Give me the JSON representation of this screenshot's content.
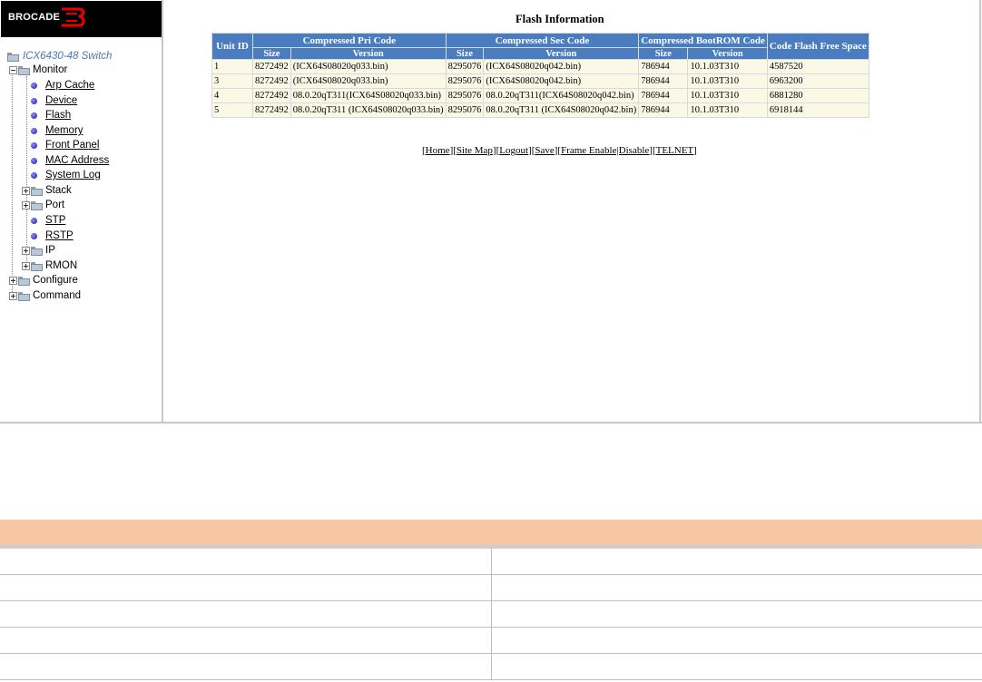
{
  "brand": {
    "name": "BROCADE",
    "logo_color": "#e60000"
  },
  "tree": {
    "root": "ICX6430-48 Switch",
    "monitor": {
      "label": "Monitor",
      "items": [
        {
          "label": "Arp Cache"
        },
        {
          "label": "Device"
        },
        {
          "label": "Flash"
        },
        {
          "label": "Memory"
        },
        {
          "label": "Front Panel"
        },
        {
          "label": "MAC Address"
        },
        {
          "label": "System Log"
        }
      ],
      "folders": {
        "stack": "Stack",
        "port": "Port",
        "ip": "IP",
        "rmon": "RMON"
      },
      "links": {
        "stp": "STP",
        "rstp": "RSTP"
      }
    },
    "configure": "Configure",
    "command": "Command"
  },
  "flash": {
    "title": "Flash Information",
    "headers": {
      "unit_id": "Unit ID",
      "pri": "Compressed Pri Code",
      "sec": "Compressed Sec Code",
      "bootrom": "Compressed BootROM Code",
      "free": "Code Flash Free Space",
      "size": "Size",
      "version": "Version"
    },
    "rows": [
      {
        "unit": "1",
        "pri_size": "8272492",
        "pri_ver": "(ICX64S08020q033.bin)",
        "sec_size": "8295076",
        "sec_ver": "(ICX64S08020q042.bin)",
        "boot_size": "786944",
        "boot_ver": "10.1.03T310",
        "free": "4587520"
      },
      {
        "unit": "3",
        "pri_size": "8272492",
        "pri_ver": "(ICX64S08020q033.bin)",
        "sec_size": "8295076",
        "sec_ver": "(ICX64S08020q042.bin)",
        "boot_size": "786944",
        "boot_ver": "10.1.03T310",
        "free": "6963200"
      },
      {
        "unit": "4",
        "pri_size": "8272492",
        "pri_ver": "08.0.20qT311(ICX64S08020q033.bin)",
        "sec_size": "8295076",
        "sec_ver": "08.0.20qT311(ICX64S08020q042.bin)",
        "boot_size": "786944",
        "boot_ver": "10.1.03T310",
        "free": "6881280"
      },
      {
        "unit": "5",
        "pri_size": "8272492",
        "pri_ver": "08.0.20qT311 (ICX64S08020q033.bin)",
        "sec_size": "8295076",
        "sec_ver": "08.0.20qT311 (ICX64S08020q042.bin)",
        "boot_size": "786944",
        "boot_ver": "10.1.03T310",
        "free": "6918144"
      }
    ]
  },
  "nav_links": {
    "home": "Home",
    "site_map": "Site Map",
    "logout": "Logout",
    "save": "Save",
    "frame": "Frame Enable|Disable",
    "telnet": "TELNET"
  },
  "colors": {
    "header_blue": "#4a7dbf",
    "cell_bg": "#fbf8e6",
    "doc_header": "#f7c7a3"
  }
}
